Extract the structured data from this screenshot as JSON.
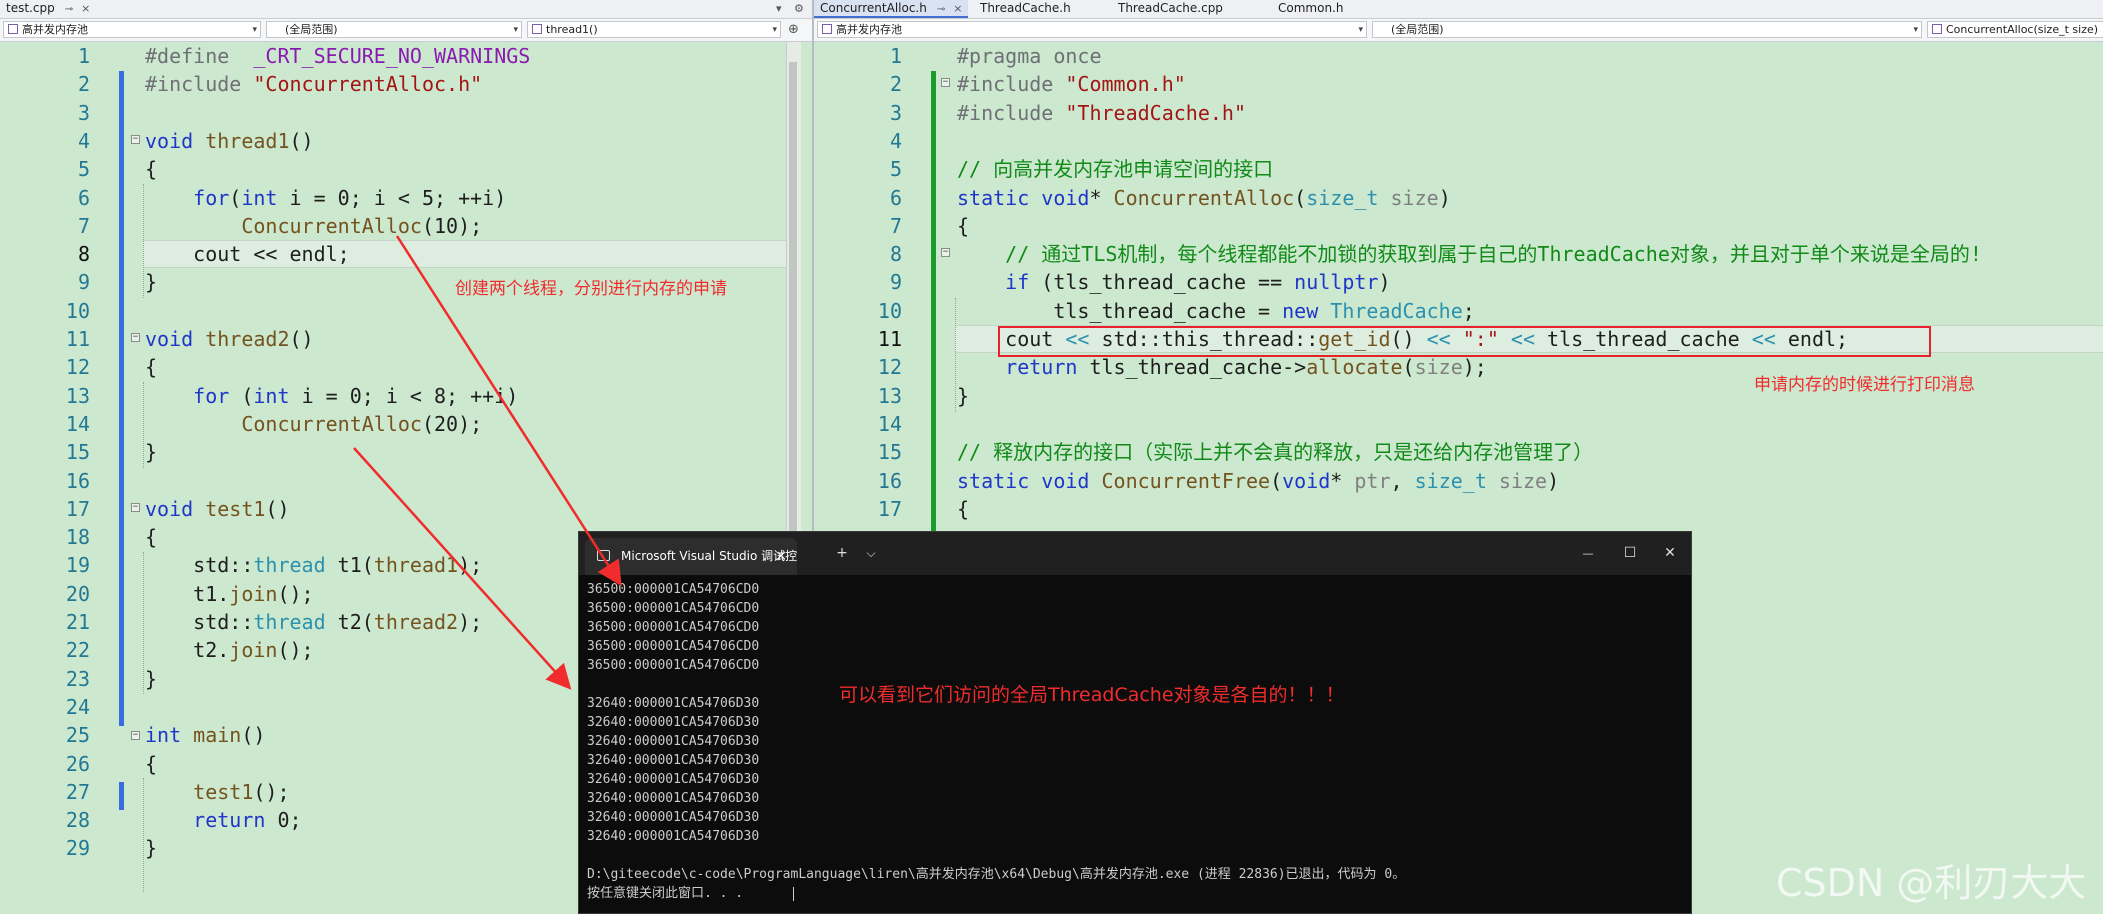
{
  "left_editor": {
    "tab": {
      "label": "test.cpp",
      "pin": "⊸",
      "close": "×"
    },
    "bar_buttons": {
      "dropdown": "▾",
      "settings": "⚙"
    },
    "nav": {
      "project": "高并发内存池",
      "scope": "(全局范围)",
      "member": "thread1()",
      "arrow": "▾",
      "split_button": "⊕"
    },
    "lines": [
      {
        "n": "1",
        "segs": [
          [
            "pp",
            "#define  "
          ],
          [
            "mac",
            "_CRT_SECURE_NO_WARNINGS"
          ]
        ]
      },
      {
        "n": "2",
        "segs": [
          [
            "pp",
            "#include "
          ],
          [
            "str",
            "\"ConcurrentAlloc.h\""
          ]
        ]
      },
      {
        "n": "3",
        "segs": []
      },
      {
        "n": "4",
        "segs": [
          [
            "kw",
            "void "
          ],
          [
            "fn",
            "thread1"
          ],
          [
            "nm",
            "()"
          ]
        ]
      },
      {
        "n": "5",
        "segs": [
          [
            "nm",
            "{"
          ]
        ]
      },
      {
        "n": "6",
        "segs": [
          [
            "nm",
            "    "
          ],
          [
            "kw",
            "for"
          ],
          [
            "nm",
            "("
          ],
          [
            "kw",
            "int "
          ],
          [
            "nm",
            "i = 0; i < 5; ++i)"
          ]
        ]
      },
      {
        "n": "7",
        "segs": [
          [
            "nm",
            "        "
          ],
          [
            "fn",
            "ConcurrentAlloc"
          ],
          [
            "nm",
            "(10);"
          ]
        ]
      },
      {
        "n": "8",
        "segs": [
          [
            "nm",
            "    cout << endl;"
          ]
        ]
      },
      {
        "n": "9",
        "segs": [
          [
            "nm",
            "}"
          ]
        ]
      },
      {
        "n": "10",
        "segs": []
      },
      {
        "n": "11",
        "segs": [
          [
            "kw",
            "void "
          ],
          [
            "fn",
            "thread2"
          ],
          [
            "nm",
            "()"
          ]
        ]
      },
      {
        "n": "12",
        "segs": [
          [
            "nm",
            "{"
          ]
        ]
      },
      {
        "n": "13",
        "segs": [
          [
            "nm",
            "    "
          ],
          [
            "kw",
            "for "
          ],
          [
            "nm",
            "("
          ],
          [
            "kw",
            "int "
          ],
          [
            "nm",
            "i = 0; i < 8; ++i)"
          ]
        ]
      },
      {
        "n": "14",
        "segs": [
          [
            "nm",
            "        "
          ],
          [
            "fn",
            "ConcurrentAlloc"
          ],
          [
            "nm",
            "(20);"
          ]
        ]
      },
      {
        "n": "15",
        "segs": [
          [
            "nm",
            "}"
          ]
        ]
      },
      {
        "n": "16",
        "segs": []
      },
      {
        "n": "17",
        "segs": [
          [
            "kw",
            "void "
          ],
          [
            "fn",
            "test1"
          ],
          [
            "nm",
            "()"
          ]
        ]
      },
      {
        "n": "18",
        "segs": [
          [
            "nm",
            "{"
          ]
        ]
      },
      {
        "n": "19",
        "segs": [
          [
            "nm",
            "    std::"
          ],
          [
            "ty",
            "thread "
          ],
          [
            "nm",
            "t1("
          ],
          [
            "fn",
            "thread1"
          ],
          [
            "nm",
            ");"
          ]
        ]
      },
      {
        "n": "20",
        "segs": [
          [
            "nm",
            "    t1."
          ],
          [
            "fn",
            "join"
          ],
          [
            "nm",
            "();"
          ]
        ]
      },
      {
        "n": "21",
        "segs": [
          [
            "nm",
            "    std::"
          ],
          [
            "ty",
            "thread "
          ],
          [
            "nm",
            "t2("
          ],
          [
            "fn",
            "thread2"
          ],
          [
            "nm",
            ");"
          ]
        ]
      },
      {
        "n": "22",
        "segs": [
          [
            "nm",
            "    t2."
          ],
          [
            "fn",
            "join"
          ],
          [
            "nm",
            "();"
          ]
        ]
      },
      {
        "n": "23",
        "segs": [
          [
            "nm",
            "}"
          ]
        ]
      },
      {
        "n": "24",
        "segs": []
      },
      {
        "n": "25",
        "segs": [
          [
            "kw",
            "int "
          ],
          [
            "fn",
            "main"
          ],
          [
            "nm",
            "()"
          ]
        ]
      },
      {
        "n": "26",
        "segs": [
          [
            "nm",
            "{"
          ]
        ]
      },
      {
        "n": "27",
        "segs": [
          [
            "nm",
            "    "
          ],
          [
            "fn",
            "test1"
          ],
          [
            "nm",
            "();"
          ]
        ]
      },
      {
        "n": "28",
        "segs": [
          [
            "nm",
            "    "
          ],
          [
            "kw",
            "return "
          ],
          [
            "nm",
            "0;"
          ]
        ]
      },
      {
        "n": "29",
        "segs": [
          [
            "nm",
            "}"
          ]
        ]
      }
    ],
    "current_line": "8"
  },
  "right_editor": {
    "tabs": [
      {
        "label": "ConcurrentAlloc.h",
        "pin": "⊸",
        "close": "×"
      },
      {
        "label": "ThreadCache.h"
      },
      {
        "label": "ThreadCache.cpp"
      },
      {
        "label": "Common.h"
      }
    ],
    "nav": {
      "project": "高并发内存池",
      "scope": "(全局范围)",
      "member": "ConcurrentAlloc(size_t size)",
      "arrow": "▾"
    },
    "lines": [
      {
        "n": "1",
        "segs": [
          [
            "pp",
            "#pragma once"
          ]
        ]
      },
      {
        "n": "2",
        "segs": [
          [
            "pp",
            "#include "
          ],
          [
            "str",
            "\"Common.h\""
          ]
        ]
      },
      {
        "n": "3",
        "segs": [
          [
            "pp",
            "#include "
          ],
          [
            "str",
            "\"ThreadCache.h\""
          ]
        ]
      },
      {
        "n": "4",
        "segs": []
      },
      {
        "n": "5",
        "segs": [
          [
            "cm",
            "// 向高并发内存池申请空间的接口"
          ]
        ]
      },
      {
        "n": "6",
        "segs": [
          [
            "kw",
            "static void"
          ],
          [
            "nm",
            "* "
          ],
          [
            "fn",
            "ConcurrentAlloc"
          ],
          [
            "nm",
            "("
          ],
          [
            "ty",
            "size_t "
          ],
          [
            "pr",
            "size"
          ],
          [
            "nm",
            ")"
          ]
        ]
      },
      {
        "n": "7",
        "segs": [
          [
            "nm",
            "{"
          ]
        ]
      },
      {
        "n": "8",
        "segs": [
          [
            "nm",
            "    "
          ],
          [
            "cm",
            "// 通过TLS机制，每个线程都能不加锁的获取到属于自己的ThreadCache对象，并且对于单个来说是全局的!"
          ]
        ]
      },
      {
        "n": "9",
        "segs": [
          [
            "nm",
            "    "
          ],
          [
            "kw",
            "if "
          ],
          [
            "nm",
            "(tls_thread_cache == "
          ],
          [
            "kw",
            "nullptr"
          ],
          [
            "nm",
            ")"
          ]
        ]
      },
      {
        "n": "10",
        "segs": [
          [
            "nm",
            "        tls_thread_cache = "
          ],
          [
            "kw",
            "new "
          ],
          [
            "ty",
            "ThreadCache"
          ],
          [
            "nm",
            ";"
          ]
        ]
      },
      {
        "n": "11",
        "segs": [
          [
            "nm",
            "    cout "
          ],
          [
            "ty",
            "<< "
          ],
          [
            "nm",
            "std::this_thread::"
          ],
          [
            "fn",
            "get_id"
          ],
          [
            "nm",
            "() "
          ],
          [
            "ty",
            "<< "
          ],
          [
            "str",
            "\":\" "
          ],
          [
            "ty",
            "<< "
          ],
          [
            "nm",
            "tls_thread_cache "
          ],
          [
            "ty",
            "<< "
          ],
          [
            "nm",
            "endl;"
          ]
        ]
      },
      {
        "n": "12",
        "segs": [
          [
            "nm",
            "    "
          ],
          [
            "kw",
            "return "
          ],
          [
            "nm",
            "tls_thread_cache->"
          ],
          [
            "fn",
            "allocate"
          ],
          [
            "nm",
            "("
          ],
          [
            "pr",
            "size"
          ],
          [
            "nm",
            ");"
          ]
        ]
      },
      {
        "n": "13",
        "segs": [
          [
            "nm",
            "}"
          ]
        ]
      },
      {
        "n": "14",
        "segs": []
      },
      {
        "n": "15",
        "segs": [
          [
            "cm",
            "// 释放内存的接口（实际上并不会真的释放，只是还给内存池管理了）"
          ]
        ]
      },
      {
        "n": "16",
        "segs": [
          [
            "kw",
            "static void "
          ],
          [
            "fn",
            "ConcurrentFree"
          ],
          [
            "nm",
            "("
          ],
          [
            "kw",
            "void"
          ],
          [
            "nm",
            "* "
          ],
          [
            "pr",
            "ptr"
          ],
          [
            "nm",
            ", "
          ],
          [
            "ty",
            "size_t "
          ],
          [
            "pr",
            "size"
          ],
          [
            "nm",
            ")"
          ]
        ]
      },
      {
        "n": "17",
        "segs": [
          [
            "nm",
            "{"
          ]
        ]
      }
    ],
    "current_line": "11"
  },
  "console": {
    "tab_title": "Microsoft Visual Studio 调试控制台",
    "tab_close": "×",
    "new_tab": "+",
    "dropdown": "⌵",
    "minimize": "—",
    "maximize": "☐",
    "close": "✕",
    "output": [
      "36500:000001CA54706CD0",
      "36500:000001CA54706CD0",
      "36500:000001CA54706CD0",
      "36500:000001CA54706CD0",
      "36500:000001CA54706CD0",
      "",
      "32640:000001CA54706D30",
      "32640:000001CA54706D30",
      "32640:000001CA54706D30",
      "32640:000001CA54706D30",
      "32640:000001CA54706D30",
      "32640:000001CA54706D30",
      "32640:000001CA54706D30",
      "32640:000001CA54706D30",
      "",
      "D:\\giteecode\\c-code\\ProgramLanguage\\liren\\高并发内存池\\x64\\Debug\\高并发内存池.exe (进程 22836)已退出，代码为 0。",
      "按任意键关闭此窗口. . ."
    ]
  },
  "annotations": {
    "threads_note": "创建两个线程，分别进行内存的申请",
    "print_note": "申请内存的时候进行打印消息",
    "result_note": "可以看到它们访问的全局ThreadCache对象是各自的！！！"
  },
  "watermark": "CSDN @利刃大大",
  "colors": {
    "editor_bg": "#cce8cf",
    "annotation_red": "#f02c2c",
    "keyword": "#1f37c8",
    "comment": "#118a18",
    "string": "#a31515",
    "console_bg": "#0c0c0c"
  }
}
